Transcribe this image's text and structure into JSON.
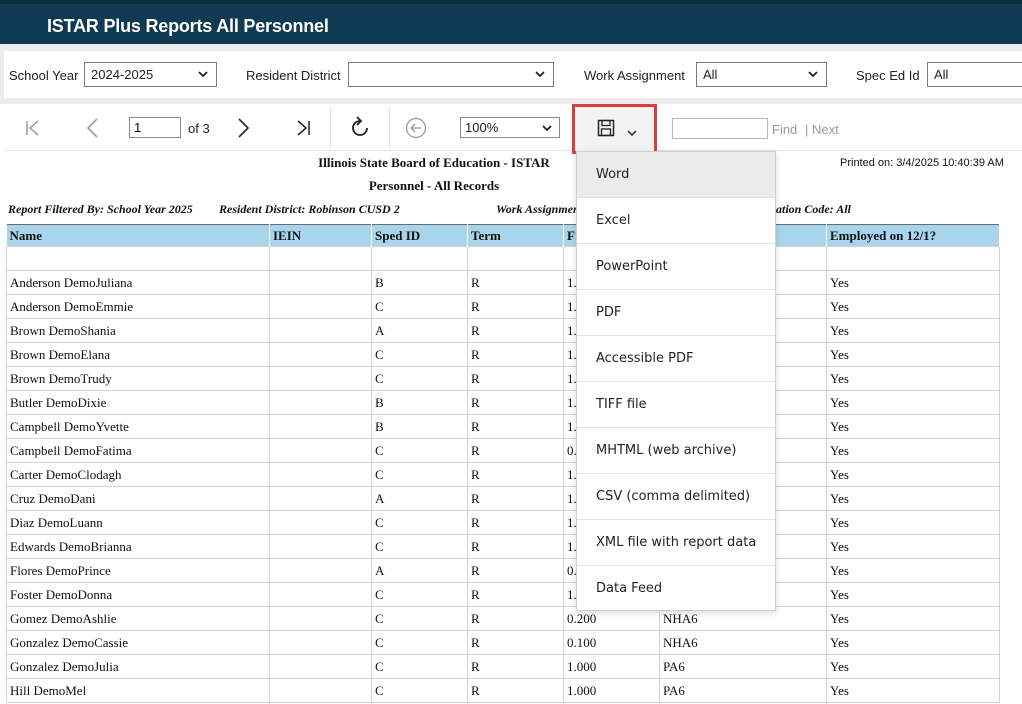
{
  "header": {
    "title": "ISTAR Plus Reports All Personnel"
  },
  "params": {
    "school_year": {
      "label": "School Year",
      "value": "2024-2025"
    },
    "resident_district": {
      "label": "Resident District",
      "value": ""
    },
    "work_assignment": {
      "label": "Work Assignment",
      "value": "All"
    },
    "spec_ed_id": {
      "label": "Spec Ed Id",
      "value": "All"
    }
  },
  "toolbar": {
    "page_value": "1",
    "page_of": "of 3",
    "zoom": "100%",
    "find_label": "Find",
    "next_label": "| Next",
    "icons": [
      "first-page-icon",
      "prev-page-icon",
      "next-page-icon",
      "last-page-icon",
      "refresh-icon",
      "back-icon",
      "save-icon",
      "chevron-down-icon"
    ]
  },
  "report": {
    "title": "Illinois State Board of Education - ISTAR",
    "subtitle": "Personnel - All Records",
    "printed_on": "Printed on: 3/4/2025 10:40:39 AM",
    "filter_a": "Report Filtered By: School Year 2025",
    "filter_b": "Resident District: Robinson CUSD 2",
    "filter_c": "Work Assignmen",
    "filter_d": "ation Code: All",
    "columns": {
      "name": "Name",
      "iein": "IEIN",
      "sped": "Sped ID",
      "term": "Term",
      "fte": "F",
      "pos": "",
      "emp": "Employed on 12/1?"
    },
    "rows": [
      {
        "name": "Anderson  DemoJuliana",
        "iein": "",
        "sped": "B",
        "term": "R",
        "fte": "1.",
        "pos": "",
        "emp": "Yes"
      },
      {
        "name": "Anderson  DemoEmmie",
        "iein": "",
        "sped": "C",
        "term": "R",
        "fte": "1.",
        "pos": "",
        "emp": "Yes"
      },
      {
        "name": "Brown  DemoShania",
        "iein": "",
        "sped": "A",
        "term": "R",
        "fte": "1.",
        "pos": "",
        "emp": "Yes"
      },
      {
        "name": "Brown  DemoElana",
        "iein": "",
        "sped": "C",
        "term": "R",
        "fte": "1.",
        "pos": "",
        "emp": "Yes"
      },
      {
        "name": "Brown  DemoTrudy",
        "iein": "",
        "sped": "C",
        "term": "R",
        "fte": "1.",
        "pos": "",
        "emp": "Yes"
      },
      {
        "name": "Butler  DemoDixie",
        "iein": "",
        "sped": "B",
        "term": "R",
        "fte": "1.",
        "pos": "",
        "emp": "Yes"
      },
      {
        "name": "Campbell  DemoYvette",
        "iein": "",
        "sped": "B",
        "term": "R",
        "fte": "1.",
        "pos": "",
        "emp": "Yes"
      },
      {
        "name": "Campbell  DemoFatima",
        "iein": "",
        "sped": "C",
        "term": "R",
        "fte": "0.",
        "pos": "",
        "emp": "Yes"
      },
      {
        "name": "Carter  DemoClodagh",
        "iein": "",
        "sped": "C",
        "term": "R",
        "fte": "1.",
        "pos": "",
        "emp": "Yes"
      },
      {
        "name": "Cruz  DemoDani",
        "iein": "",
        "sped": "A",
        "term": "R",
        "fte": "1.",
        "pos": "",
        "emp": "Yes"
      },
      {
        "name": "Diaz  DemoLuann",
        "iein": "",
        "sped": "C",
        "term": "R",
        "fte": "1.",
        "pos": "",
        "emp": "Yes"
      },
      {
        "name": "Edwards  DemoBrianna",
        "iein": "",
        "sped": "C",
        "term": "R",
        "fte": "1.",
        "pos": "",
        "emp": "Yes"
      },
      {
        "name": "Flores  DemoPrince",
        "iein": "",
        "sped": "A",
        "term": "R",
        "fte": "0.",
        "pos": "",
        "emp": "Yes"
      },
      {
        "name": "Foster  DemoDonna",
        "iein": "",
        "sped": "C",
        "term": "R",
        "fte": "1.",
        "pos": "",
        "emp": "Yes"
      },
      {
        "name": "Gomez  DemoAshlie",
        "iein": "",
        "sped": "C",
        "term": "R",
        "fte": "0.200",
        "pos": "NHA6",
        "emp": "Yes"
      },
      {
        "name": "Gonzalez  DemoCassie",
        "iein": "",
        "sped": "C",
        "term": "R",
        "fte": "0.100",
        "pos": "NHA6",
        "emp": "Yes"
      },
      {
        "name": "Gonzalez  DemoJulia",
        "iein": "",
        "sped": "C",
        "term": "R",
        "fte": "1.000",
        "pos": "PA6",
        "emp": "Yes"
      },
      {
        "name": "Hill  DemoMel",
        "iein": "",
        "sped": "C",
        "term": "R",
        "fte": "1.000",
        "pos": "PA6",
        "emp": "Yes"
      }
    ]
  },
  "export_menu": {
    "items": [
      "Word",
      "Excel",
      "PowerPoint",
      "PDF",
      "Accessible PDF",
      "TIFF file",
      "MHTML (web archive)",
      "CSV (comma delimited)",
      "XML file with report data",
      "Data Feed"
    ]
  },
  "colors": {
    "header_bg": "#0f3a52",
    "table_header_bg": "#a9d5ec",
    "highlight_border": "#e03c3c"
  }
}
